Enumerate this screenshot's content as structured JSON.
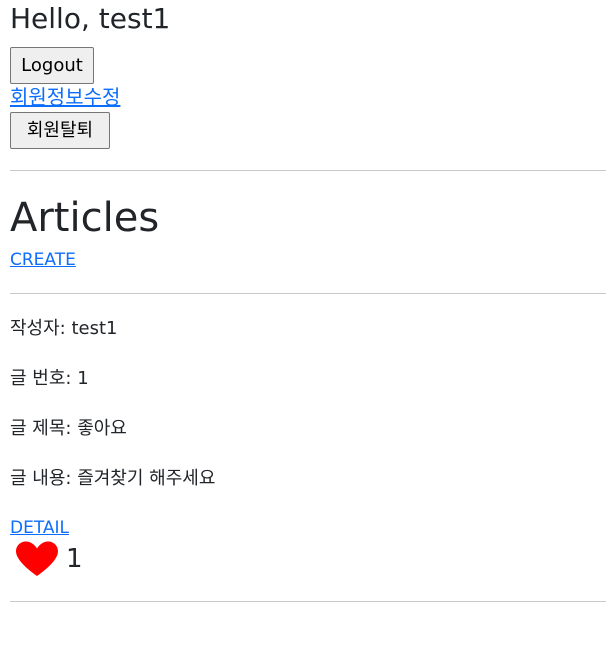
{
  "header": {
    "greeting": "Hello, test1",
    "logout_label": "Logout",
    "edit_profile_label": "회원정보수정",
    "withdraw_label": "회원탈퇴"
  },
  "articles": {
    "title": "Articles",
    "create_label": "CREATE",
    "items": [
      {
        "author_label": "작성자: ",
        "author": "test1",
        "number_label": "글 번호: ",
        "number": "1",
        "title_label": "글 제목: ",
        "title": "좋아요",
        "content_label": "글 내용: ",
        "content": "즐겨찾기 해주세요",
        "detail_label": "DETAIL",
        "like_count": "1"
      }
    ]
  },
  "colors": {
    "link": "#0d6efd",
    "heart": "#ff0000",
    "divider": "#c8c8c8"
  },
  "icons": {
    "like": "heart-icon"
  }
}
